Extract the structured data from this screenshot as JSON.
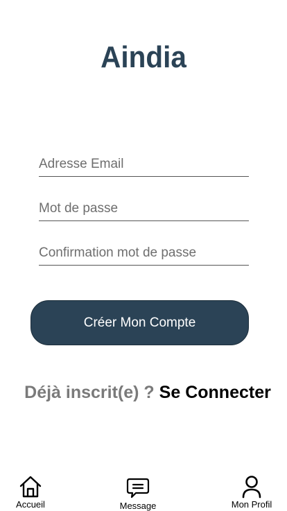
{
  "app": {
    "logo_text": "Aindia",
    "brand_color": "#2b4356"
  },
  "form": {
    "email_placeholder": "Adresse Email",
    "password_placeholder": "Mot de passe",
    "confirm_placeholder": "Confirmation mot de passe",
    "email_value": "",
    "password_value": "",
    "confirm_value": "",
    "submit_label": "Créer Mon Compte"
  },
  "login_prompt": {
    "question": "Déjà inscrit(e) ?",
    "link_label": "Se Connecter"
  },
  "tabbar": {
    "items": [
      {
        "label": "Accueil",
        "icon": "home-icon"
      },
      {
        "label": "Message",
        "icon": "message-icon"
      },
      {
        "label": "Mon Profil",
        "icon": "profile-icon"
      }
    ]
  }
}
